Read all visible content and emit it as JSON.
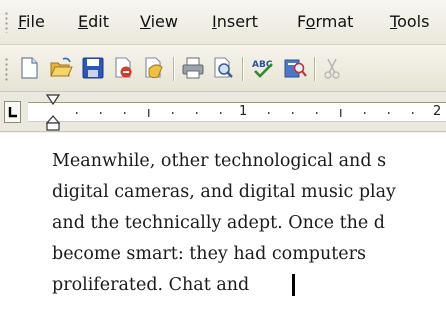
{
  "menu": {
    "items": [
      {
        "id": "file",
        "label": "File",
        "underline_index": 0
      },
      {
        "id": "edit",
        "label": "Edit",
        "underline_index": 0
      },
      {
        "id": "view",
        "label": "View",
        "underline_index": 0
      },
      {
        "id": "insert",
        "label": "Insert",
        "underline_index": 0
      },
      {
        "id": "format",
        "label": "Format",
        "underline_index": 1
      },
      {
        "id": "tools",
        "label": "Tools",
        "underline_index": 0
      }
    ]
  },
  "toolbar": {
    "buttons": [
      {
        "id": "new",
        "icon": "new-document-icon"
      },
      {
        "id": "open",
        "icon": "open-folder-icon"
      },
      {
        "id": "save",
        "icon": "save-disk-icon"
      },
      {
        "id": "permission",
        "icon": "permission-icon"
      },
      {
        "id": "email",
        "icon": "email-icon"
      },
      {
        "id": "print",
        "icon": "print-icon"
      },
      {
        "id": "print-preview",
        "icon": "print-preview-icon"
      },
      {
        "id": "spelling",
        "icon": "spelling-grammar-icon"
      },
      {
        "id": "research",
        "icon": "research-icon"
      },
      {
        "id": "cut",
        "icon": "cut-icon"
      }
    ]
  },
  "ruler": {
    "numbers": [
      "1",
      "2"
    ]
  },
  "document": {
    "lines": [
      "Meanwhile, other technological and s",
      "digital cameras, and digital music play",
      "and the technically adept. Once the d",
      "become smart: they had computers",
      "proliferated. Chat and "
    ]
  },
  "colors": {
    "chrome": "#f4f2ea",
    "page": "#ffffff",
    "text": "#1a1a1a"
  }
}
